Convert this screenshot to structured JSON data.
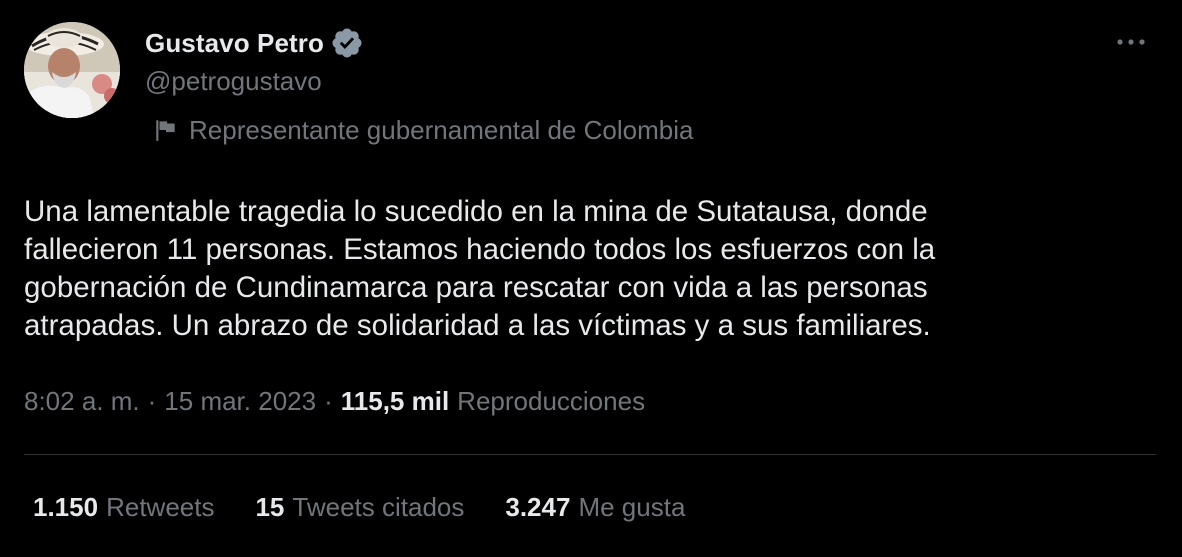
{
  "author": {
    "display_name": "Gustavo Petro",
    "handle": "@petrogustavo",
    "verified_color": "#8b98a5",
    "affiliation": "Representante gubernamental de Colombia"
  },
  "tweet": {
    "text": "Una lamentable tragedia lo sucedido en la mina de Sutatausa, donde\nfallecieron 11 personas. Estamos haciendo todos los esfuerzos con la\ngobernación de Cundinamarca para rescatar con vida a las personas\natrapadas. Un abrazo de solidaridad a las víctimas y a sus familiares."
  },
  "meta": {
    "time": "8:02 a. m.",
    "separator": "·",
    "date": "15 mar. 2023",
    "views_count": "115,5 mil",
    "views_label": "Reproducciones"
  },
  "stats": {
    "retweets_count": "1.150",
    "retweets_label": "Retweets",
    "quotes_count": "15",
    "quotes_label": "Tweets citados",
    "likes_count": "3.247",
    "likes_label": "Me gusta"
  },
  "colors": {
    "background": "#000000",
    "primary_text": "#e7e9ea",
    "secondary_text": "#71767b",
    "divider": "#2f3336"
  },
  "icons": {
    "verified": "verified-badge-icon",
    "affiliation": "flag-icon",
    "more": "more-options-icon"
  }
}
